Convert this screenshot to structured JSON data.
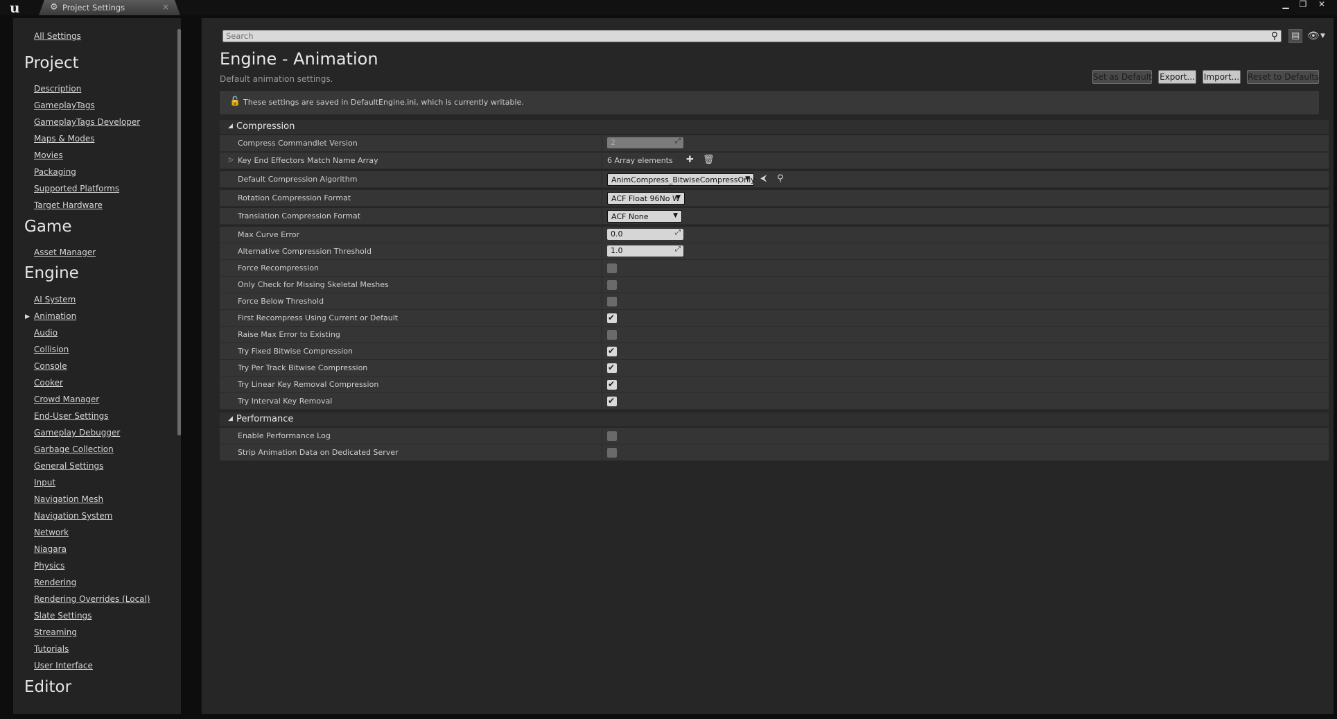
{
  "window": {
    "logo": "u",
    "tab_title": "Project Settings",
    "tab_icon": "gear-icon",
    "tab_close": "×",
    "minimize": "▁",
    "maximize": "❐",
    "close": "✕"
  },
  "sidebar": {
    "all_settings": "All Settings",
    "sections": [
      {
        "title": "Project",
        "items": [
          "Description",
          "GameplayTags",
          "GameplayTags Developer",
          "Maps & Modes",
          "Movies",
          "Packaging",
          "Supported Platforms",
          "Target Hardware"
        ]
      },
      {
        "title": "Game",
        "items": [
          "Asset Manager"
        ]
      },
      {
        "title": "Engine",
        "items": [
          "AI System",
          "Animation",
          "Audio",
          "Collision",
          "Console",
          "Cooker",
          "Crowd Manager",
          "End-User Settings",
          "Gameplay Debugger",
          "Garbage Collection",
          "General Settings",
          "Input",
          "Navigation Mesh",
          "Navigation System",
          "Network",
          "Niagara",
          "Physics",
          "Rendering",
          "Rendering Overrides (Local)",
          "Slate Settings",
          "Streaming",
          "Tutorials",
          "User Interface"
        ]
      },
      {
        "title": "Editor",
        "items": []
      }
    ],
    "selected": "Animation"
  },
  "search": {
    "placeholder": "Search"
  },
  "header": {
    "title": "Engine - Animation",
    "subtitle": "Default animation settings.",
    "buttons": {
      "set_default": "Set as Default",
      "export": "Export...",
      "import": "Import...",
      "reset": "Reset to Defaults"
    }
  },
  "notice": {
    "text": "These settings are saved in DefaultEngine.ini, which is currently writable."
  },
  "compression": {
    "title": "Compression",
    "rows": [
      {
        "label": "Compress Commandlet Version",
        "value": "2"
      },
      {
        "label": "Key End Effectors Match Name Array",
        "value": "6 Array elements"
      },
      {
        "label": "Default Compression Algorithm",
        "value": "AnimCompress_BitwiseCompressOnly"
      },
      {
        "label": "Rotation Compression Format",
        "value": "ACF Float 96No W"
      },
      {
        "label": "Translation Compression Format",
        "value": "ACF None"
      },
      {
        "label": "Max Curve Error",
        "value": "0.0"
      },
      {
        "label": "Alternative Compression Threshold",
        "value": "1.0"
      },
      {
        "label": "Force Recompression",
        "checked": false
      },
      {
        "label": "Only Check for Missing Skeletal Meshes",
        "checked": false
      },
      {
        "label": "Force Below Threshold",
        "checked": false
      },
      {
        "label": "First Recompress Using Current or Default",
        "checked": true
      },
      {
        "label": "Raise Max Error to Existing",
        "checked": false
      },
      {
        "label": "Try Fixed Bitwise Compression",
        "checked": true
      },
      {
        "label": "Try Per Track Bitwise Compression",
        "checked": true
      },
      {
        "label": "Try Linear Key Removal Compression",
        "checked": true
      },
      {
        "label": "Try Interval Key Removal",
        "checked": true
      }
    ]
  },
  "performance": {
    "title": "Performance",
    "rows": [
      {
        "label": "Enable Performance Log",
        "checked": false
      },
      {
        "label": "Strip Animation Data on Dedicated Server",
        "checked": false
      }
    ]
  },
  "glyphs": {
    "check": "✔",
    "caret": "▼",
    "grip": "⤢",
    "tri_open": "◢",
    "tri_closed": "▷",
    "plus": "✚",
    "trash": "🗑",
    "back": "⮜",
    "search": "⚲"
  }
}
